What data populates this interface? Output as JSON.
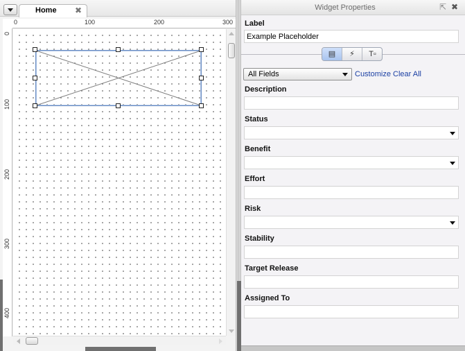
{
  "tabs": {
    "menu_icon": "chevron-down-icon",
    "home_label": "Home",
    "close_glyph": "✖"
  },
  "rulers": {
    "top": [
      "0",
      "100",
      "200",
      "300"
    ],
    "left": [
      "0",
      "100",
      "200",
      "300",
      "400"
    ]
  },
  "widget": {
    "type": "placeholder"
  },
  "properties": {
    "title": "Widget Properties",
    "popout_glyph": "⇱",
    "close_glyph": "✖",
    "label_heading": "Label",
    "label_value": "Example Placeholder",
    "tool_icons": [
      "properties-icon",
      "interactions-icon",
      "text-format-icon"
    ],
    "tool_glyphs": [
      "▤",
      "⚡",
      "T▫"
    ],
    "fields_select": "All Fields",
    "customize_link": "Customize",
    "clear_all_link": "Clear All",
    "fields": [
      {
        "label": "Description",
        "kind": "text",
        "value": ""
      },
      {
        "label": "Status",
        "kind": "dropdown",
        "value": ""
      },
      {
        "label": "Benefit",
        "kind": "dropdown",
        "value": ""
      },
      {
        "label": "Effort",
        "kind": "text",
        "value": ""
      },
      {
        "label": "Risk",
        "kind": "dropdown",
        "value": ""
      },
      {
        "label": "Stability",
        "kind": "text",
        "value": ""
      },
      {
        "label": "Target Release",
        "kind": "text",
        "value": ""
      },
      {
        "label": "Assigned To",
        "kind": "text",
        "value": ""
      }
    ]
  },
  "colors": {
    "selection_border": "#6c8fc4",
    "link": "#1a3fa3",
    "active_tool": "#a9c4ee"
  }
}
